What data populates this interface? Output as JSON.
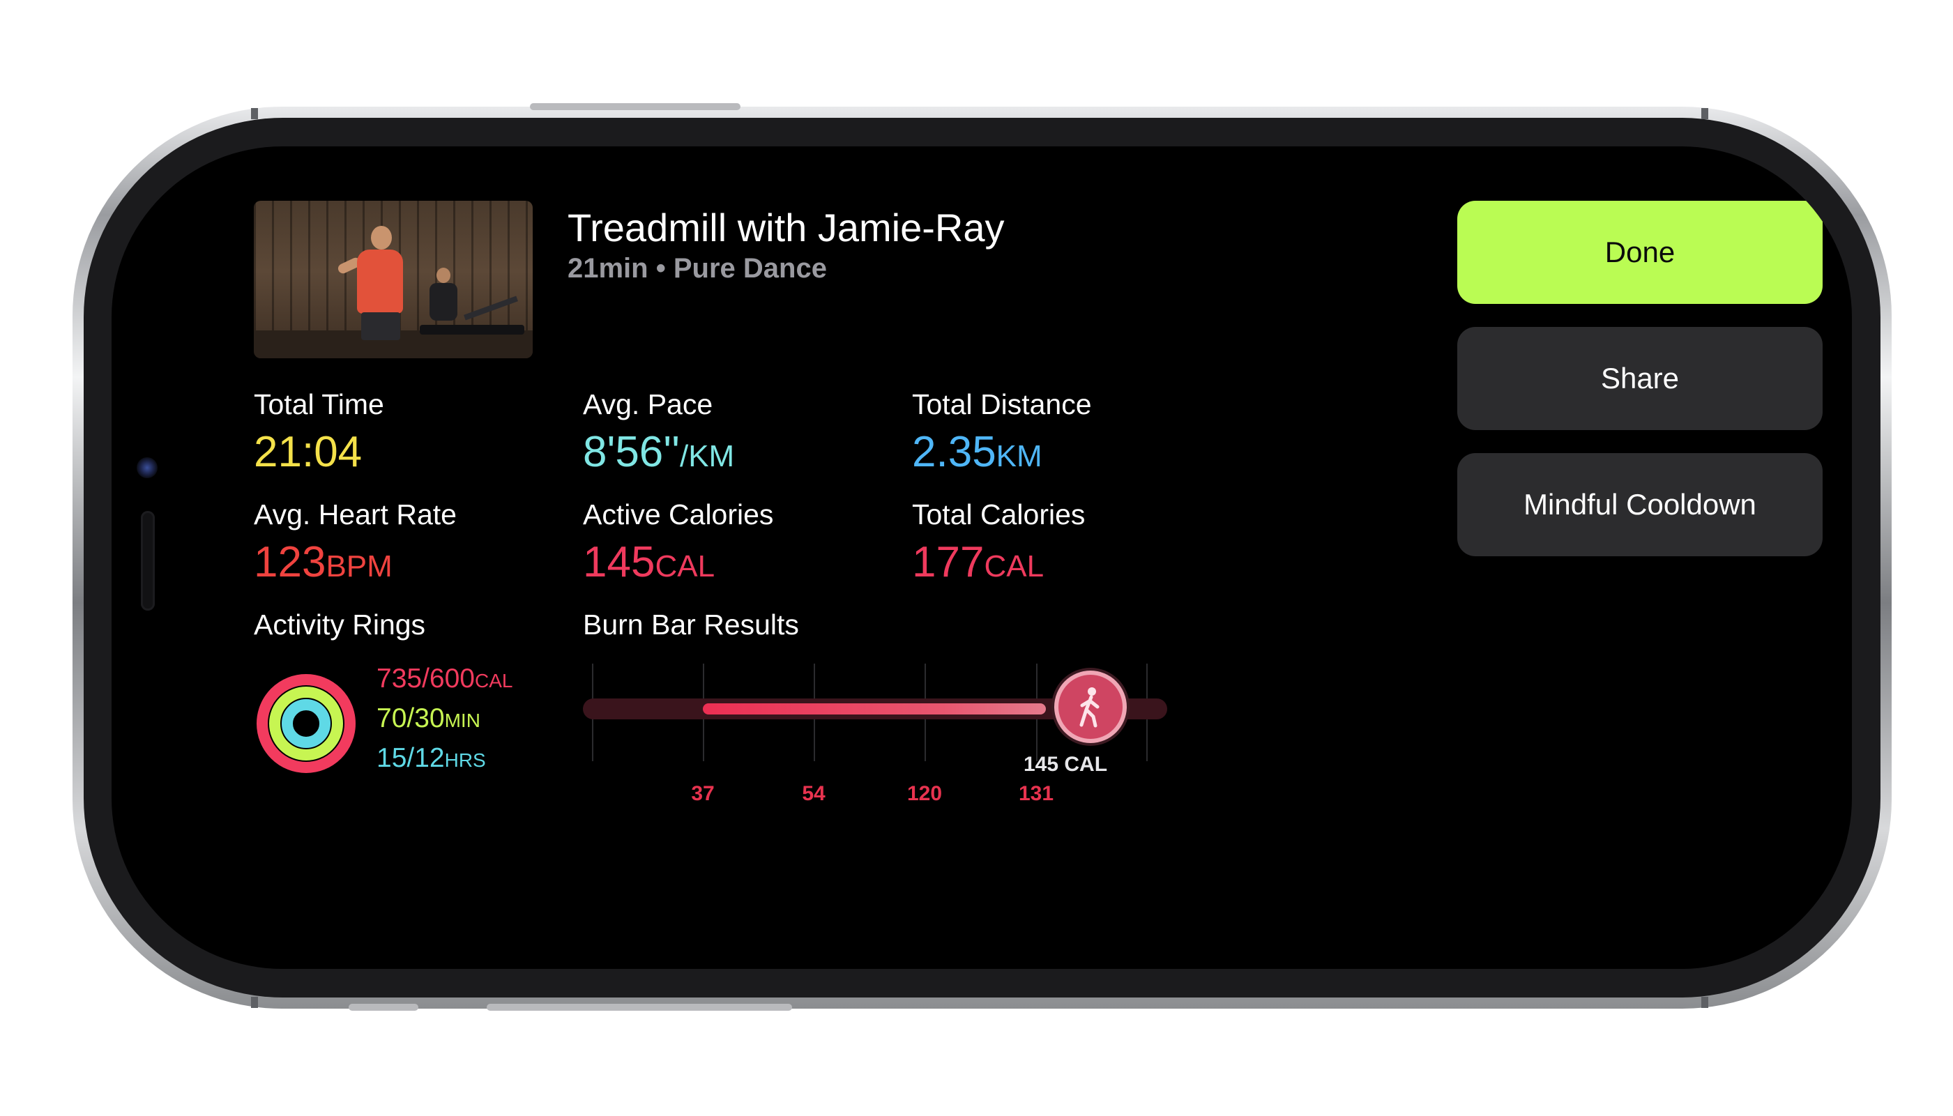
{
  "workout": {
    "title": "Treadmill with Jamie-Ray",
    "subtitle": "21min • Pure Dance"
  },
  "metrics": [
    {
      "label": "Total Time",
      "value": "21:04",
      "unit": "",
      "color": "#f4e14a"
    },
    {
      "label": "Avg. Pace",
      "value": "8'56''",
      "unit": "/KM",
      "color": "#80e6e4"
    },
    {
      "label": "Total Distance",
      "value": "2.35",
      "unit": "KM",
      "color": "#4fb6f7"
    },
    {
      "label": "Avg. Heart Rate",
      "value": "123",
      "unit": "BPM",
      "color": "#f0433f"
    },
    {
      "label": "Active Calories",
      "value": "145",
      "unit": "CAL",
      "color": "#ef3a5d"
    },
    {
      "label": "Total Calories",
      "value": "177",
      "unit": "CAL",
      "color": "#ef3a5d"
    }
  ],
  "activity_rings": {
    "label": "Activity Rings",
    "move": {
      "value": "735/600",
      "unit": "CAL",
      "color": "#f23b5e",
      "fraction": 1.0
    },
    "exercise": {
      "value": "70/30",
      "unit": "MIN",
      "color": "#c7f552",
      "fraction": 1.0
    },
    "stand": {
      "value": "15/12",
      "unit": "HRS",
      "color": "#5fd9e6",
      "fraction": 1.0
    }
  },
  "burn_bar": {
    "label": "Burn Bar Results",
    "marker_value": "145 CAL",
    "marker_icon": "walking-figure-icon",
    "axis_labels": [
      "37",
      "54",
      "120",
      "131"
    ]
  },
  "buttons": {
    "done": "Done",
    "share": "Share",
    "cooldown": "Mindful Cooldown"
  },
  "colors": {
    "accent_green": "#bafc53",
    "button_gray": "#2c2c2e",
    "burn_red": "#e8334f"
  }
}
